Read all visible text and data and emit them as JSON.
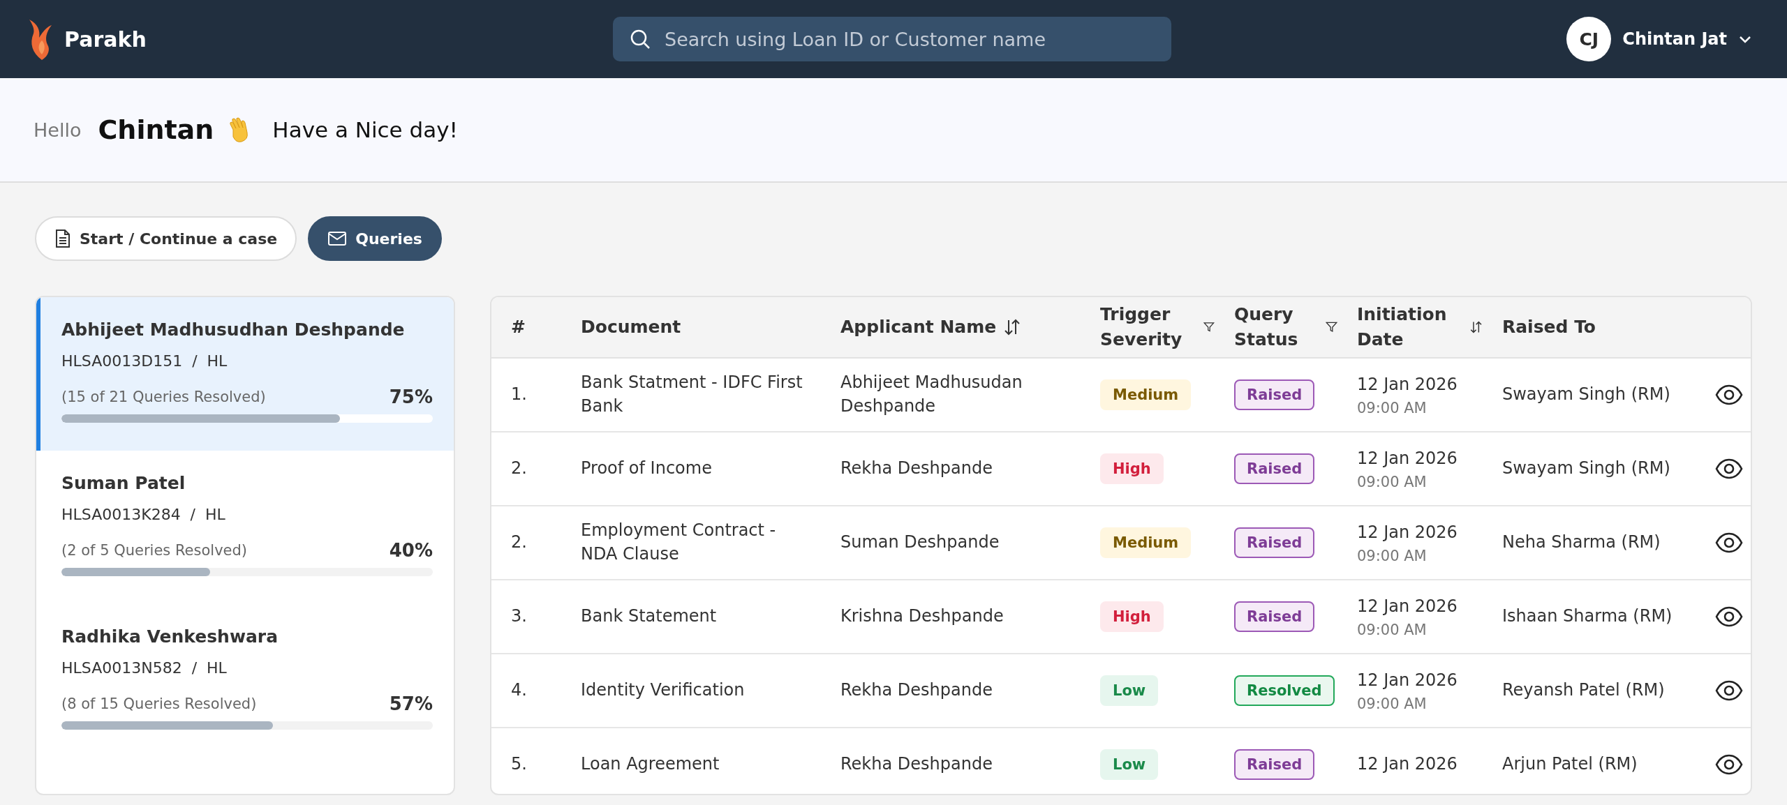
{
  "header": {
    "brand": "Parakh",
    "search": {
      "placeholder": "Search using Loan ID or Customer name"
    },
    "user": {
      "initials": "CJ",
      "name": "Chintan Jat"
    }
  },
  "greeting": {
    "hello": "Hello",
    "name": "Chintan",
    "message": "Have a Nice day!"
  },
  "nav_buttons": [
    {
      "label": "Start / Continue a case",
      "kind": "document",
      "selected": false
    },
    {
      "label": "Queries",
      "kind": "mail",
      "selected": true
    }
  ],
  "cases": [
    {
      "name": "Abhijeet Madhusudhan Deshpande",
      "id_line": "HLSA0013D151  /  HL",
      "progress_text": "(15 of 21 Queries Resolved)",
      "percent": "75%",
      "level": 0.75,
      "selected": true
    },
    {
      "name": "Suman Patel",
      "id_line": "HLSA0013K284  /  HL",
      "progress_text": "(2 of 5 Queries Resolved)",
      "percent": "40%",
      "level": 0.4,
      "selected": false
    },
    {
      "name": "Radhika Venkeshwara",
      "id_line": "HLSA0013N582  /  HL",
      "progress_text": "(8 of 15 Queries Resolved)",
      "percent": "57%",
      "level": 0.57,
      "selected": false
    }
  ],
  "table": {
    "columns": [
      {
        "label": "#",
        "kind": "plain"
      },
      {
        "label": "Document",
        "kind": "plain"
      },
      {
        "label": "Applicant Name",
        "kind": "sort"
      },
      {
        "label": "Trigger Severity",
        "kind": "filter"
      },
      {
        "label": "Query Status",
        "kind": "filter"
      },
      {
        "label": "Initiation Date",
        "kind": "sort"
      },
      {
        "label": "Raised To",
        "kind": "plain"
      }
    ],
    "rows": [
      {
        "index": "1.",
        "document": "Bank Statment - IDFC First Bank",
        "applicant": "Abhijeet Madhusudan Deshpande",
        "severity": {
          "label": "Medium",
          "kind": "medium"
        },
        "status": {
          "label": "Raised",
          "kind": "raised"
        },
        "date": "12 Jan 2026",
        "time": "09:00 AM",
        "raised_to": "Swayam Singh (RM)"
      },
      {
        "index": "2.",
        "document": "Proof of Income",
        "applicant": "Rekha Deshpande",
        "severity": {
          "label": "High",
          "kind": "high"
        },
        "status": {
          "label": "Raised",
          "kind": "raised"
        },
        "date": "12 Jan 2026",
        "time": "09:00 AM",
        "raised_to": "Swayam Singh (RM)"
      },
      {
        "index": "2.",
        "document": "Employment Contract - NDA Clause",
        "applicant": "Suman Deshpande",
        "severity": {
          "label": "Medium",
          "kind": "medium"
        },
        "status": {
          "label": "Raised",
          "kind": "raised"
        },
        "date": "12 Jan 2026",
        "time": "09:00 AM",
        "raised_to": "Neha Sharma (RM)"
      },
      {
        "index": "3.",
        "document": "Bank Statement",
        "applicant": "Krishna Deshpande",
        "severity": {
          "label": "High",
          "kind": "high"
        },
        "status": {
          "label": "Raised",
          "kind": "raised"
        },
        "date": "12 Jan 2026",
        "time": "09:00 AM",
        "raised_to": "Ishaan Sharma (RM)"
      },
      {
        "index": "4.",
        "document": "Identity Verification",
        "applicant": "Rekha Deshpande",
        "severity": {
          "label": "Low",
          "kind": "low"
        },
        "status": {
          "label": "Resolved",
          "kind": "resolved"
        },
        "date": "12 Jan 2026",
        "time": "09:00 AM",
        "raised_to": "Reyansh Patel (RM)"
      },
      {
        "index": "5.",
        "document": "Loan Agreement",
        "applicant": "Rekha Deshpande",
        "severity": {
          "label": "Low",
          "kind": "low"
        },
        "status": {
          "label": "Raised",
          "kind": "raised"
        },
        "date": "12 Jan 2026",
        "raised_to": "Arjun Patel (RM)"
      }
    ]
  }
}
